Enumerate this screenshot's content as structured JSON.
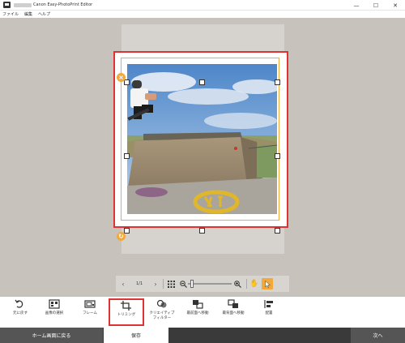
{
  "window": {
    "title": "Canon Easy-PhotoPrint Editor",
    "controls": {
      "minimize": "—",
      "maximize": "☐",
      "close": "✕"
    }
  },
  "menu": {
    "items": [
      "ファイル",
      "編集",
      "ヘルプ"
    ]
  },
  "zoombar": {
    "page_indicator": "1/1"
  },
  "toolbar": {
    "items": [
      {
        "label": "元に戻す",
        "icon": "undo-icon"
      },
      {
        "label": "画像の選択",
        "icon": "image-select-icon"
      },
      {
        "label": "フレーム",
        "icon": "frame-icon"
      },
      {
        "label": "トリミング",
        "icon": "crop-icon"
      },
      {
        "label": "クリエイティブ\nフィルター",
        "icon": "creative-filter-icon"
      },
      {
        "label": "最前面へ移動",
        "icon": "bring-to-front-icon"
      },
      {
        "label": "最背面へ移動",
        "icon": "send-to-back-icon"
      },
      {
        "label": "配置",
        "icon": "arrange-icon"
      }
    ],
    "highlighted_item": "トリミング"
  },
  "bottom": {
    "home_label": "ホーム画面に戻る",
    "save_label": "保存",
    "next_label": "次へ"
  },
  "colors": {
    "highlight": "#e03232",
    "selection": "#f2a93b",
    "workspace": "#c7c3bc",
    "bottom_bar": "#555555",
    "active_cursor": "#f2a93b"
  }
}
